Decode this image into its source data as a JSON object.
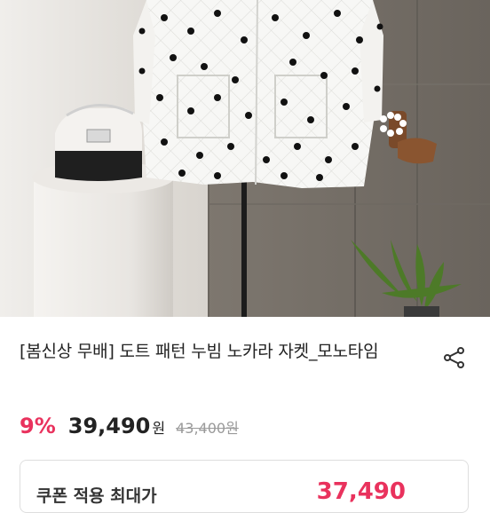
{
  "product": {
    "title": "[봄신상 무배] 도트 패턴 누빔 노카라 자켓_모노타임",
    "discount": "9%",
    "price": "39,490",
    "currency": "원",
    "original_price": "43,400원"
  },
  "icons": {
    "share": "share-icon"
  },
  "coupon": {
    "label": "쿠폰 적용 최대가",
    "price": "37,490"
  },
  "colors": {
    "accent": "#e9325d",
    "text": "#222222",
    "muted": "#9a9a9a"
  }
}
